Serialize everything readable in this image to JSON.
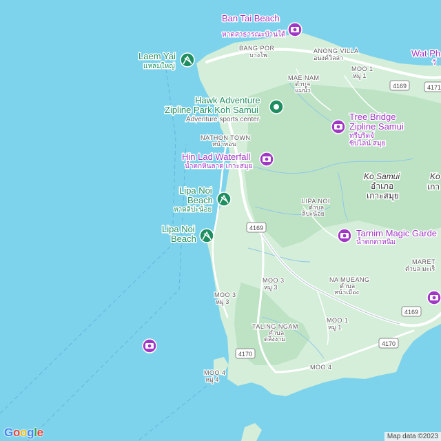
{
  "map": {
    "colors": {
      "water": "#7ed3ec",
      "land": "#d4eed9",
      "forest": "#bde3c4",
      "road": "#ffffff",
      "poi_green": "#1e8e60",
      "poi_purple": "#a038c5"
    }
  },
  "pois": {
    "ban_tai_beach": {
      "name": "Ban Tai Beach",
      "name_th": "หาดสาธารณะบ้านใต้"
    },
    "laem_yai": {
      "name": "Laem Yai",
      "name_th": "แหลมใหญ่"
    },
    "hawk_adventure": {
      "name_line1": "Hawk Adventure",
      "name_line2": "Zipline Park Koh Samui",
      "category": "Adventure sports center"
    },
    "tree_bridge": {
      "name_line1": "Tree Bridge",
      "name_line2": "Zipline Samui",
      "name_th_line1": "ทรีบริดจ์",
      "name_th_line2": "ซิปไลน์ สมุย"
    },
    "hin_lad": {
      "name": "Hin Lad Waterfall",
      "name_th": "น้ำตกหินลาด เกาะสมุย"
    },
    "lipa_noi_1": {
      "name_line1": "Lipa Noi",
      "name_line2": "Beach",
      "name_th": "หาดลิปะน้อย"
    },
    "lipa_noi_2": {
      "name_line1": "Lipa Noi",
      "name_line2": "Beach"
    },
    "tarnim": {
      "name": "Tarnim Magic Garde",
      "name_th": "น้ำตกตาหนิม"
    },
    "wat_ph": {
      "name": "Wat Ph",
      "name_th": "วั"
    }
  },
  "places": {
    "bang_por": {
      "name": "BANG POR",
      "name_th": "บางโพ"
    },
    "anong_villa": {
      "name": "ANONG VILLA",
      "name_th": "อนงค์วิลล่า"
    },
    "moo1_north": {
      "name": "MOO 1",
      "name_th": "หมู่ 1"
    },
    "mae_nam": {
      "name": "MAE NAM",
      "name_th_line1": "ตำบล",
      "name_th_line2": "แม่น้ำ"
    },
    "nathon": {
      "name": "NATHON TOWN",
      "name_th": "หน้าทอน"
    },
    "lipa_noi": {
      "name": "LIPA NOI",
      "name_th_line1": "ตำบล",
      "name_th_line2": "ลิปะน้อย"
    },
    "moo3_center": {
      "name": "MOO 3",
      "name_th": "หมู่ 3"
    },
    "moo3_west": {
      "name": "MOO 3",
      "name_th": "หมู่ 3"
    },
    "na_mueang": {
      "name": "NA MUEANG",
      "name_th_line1": "ตำบล",
      "name_th_line2": "หน้าเมือง"
    },
    "maret": {
      "name": "MARET",
      "name_th": "ตำบล มะเร็"
    },
    "taling_ngam": {
      "name": "TALING NGAM",
      "name_th_line1": "ตำบล",
      "name_th_line2": "ตลิ่งงาม"
    },
    "moo1_south": {
      "name": "MOO 1",
      "name_th": "หมู่ 1"
    },
    "moo4_center": {
      "name": "MOO 4"
    },
    "moo4_west": {
      "name": "MOO 4",
      "name_th": "หมู่ 4"
    },
    "ko_east": {
      "name": "Ko",
      "name_th": "เกา"
    }
  },
  "district": {
    "name": "Ko Samui",
    "name_th_line1": "อำเภอ",
    "name_th_line2": "เกาะสมุย"
  },
  "road_shields": {
    "r4169_ne": "4169",
    "r4171": "4171",
    "r4169_center": "4169",
    "r4169_se": "4169",
    "r4170_se": "4170",
    "r4170_sw": "4170"
  },
  "branding": {
    "g1": "G",
    "o1": "o",
    "o2": "o",
    "g2": "g",
    "l": "l",
    "e": "e",
    "attribution": "Map data ©2023"
  }
}
